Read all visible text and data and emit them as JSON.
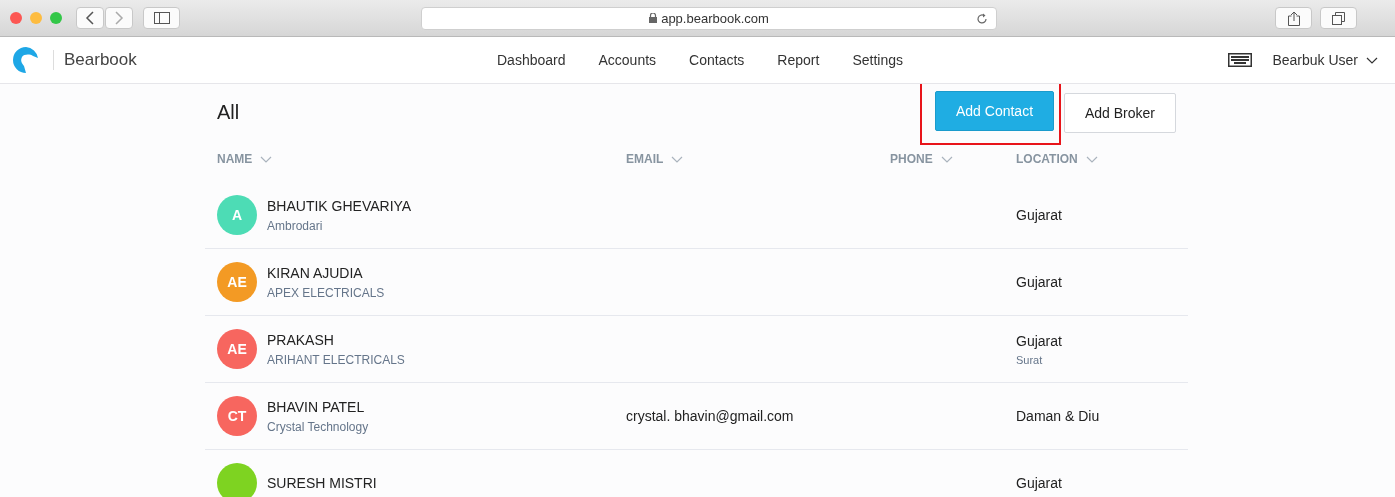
{
  "browser": {
    "url": "app.bearbook.com"
  },
  "app": {
    "name": "Bearbook",
    "nav": [
      {
        "label": "Dashboard",
        "selected": false
      },
      {
        "label": "Accounts",
        "selected": false
      },
      {
        "label": "Contacts",
        "selected": false
      },
      {
        "label": "Report",
        "selected": false
      },
      {
        "label": "Settings",
        "selected": false
      }
    ],
    "user": "Bearbuk User"
  },
  "page": {
    "title": "All",
    "buttons": [
      {
        "label": "Add Contact",
        "kind": "primary",
        "highlighted": true
      },
      {
        "label": "Add Broker",
        "kind": "secondary",
        "highlighted": false
      }
    ]
  },
  "table": {
    "columns": [
      "NAME",
      "EMAIL",
      "PHONE",
      "LOCATION"
    ],
    "rows": [
      {
        "initials": "A",
        "color": "#4ddcb5",
        "name": "BHAUTIK GHEVARIYA",
        "company": "Ambrodari",
        "location": "Gujarat"
      },
      {
        "initials": "AE",
        "color": "#f39a24",
        "name": "KIRAN AJUDIA",
        "company": "APEX ELECTRICALS",
        "location": "Gujarat"
      },
      {
        "initials": "AE",
        "color": "#f7665f",
        "name": "PRAKASH",
        "company": "ARIHANT ELECTRICALS",
        "location": "Gujarat",
        "city": "Surat"
      },
      {
        "initials": "CT",
        "color": "#f7665f",
        "name": "BHAVIN PATEL",
        "company": "Crystal Technology",
        "email": "crystal. bhavin@gmail.com",
        "location": "Daman & Diu"
      },
      {
        "color": "#7ed321",
        "name": "SURESH MISTRI",
        "location": "Gujarat"
      }
    ]
  }
}
